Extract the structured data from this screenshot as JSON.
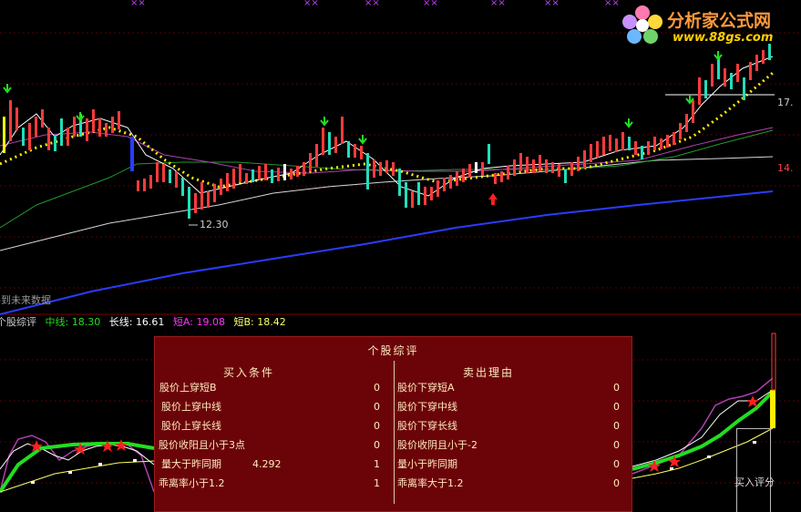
{
  "top_markers": [
    "××",
    "××",
    "××",
    "××",
    "××",
    "××",
    "××"
  ],
  "logo": {
    "name": "分析家公式网",
    "url": "www.88gs.com"
  },
  "price_labels": {
    "low_price": "12.30",
    "right_upper": "17.",
    "right_lower": "14."
  },
  "future_data_text": "得到未来数据",
  "indicator_bar": {
    "name": "个股综评",
    "mid_label": "中线:",
    "mid_value": "18.30",
    "long_label": "长线:",
    "long_value": "16.61",
    "shortA_label": "短A:",
    "shortA_value": "19.08",
    "shortB_label": "短B:",
    "shortB_value": "18.42"
  },
  "colors": {
    "panel_bg": "#6b0408",
    "mid": "#22dd22",
    "long": "#ffffff",
    "shortA": "#ff33ff",
    "shortB": "#ffff66",
    "up": "#ff3b3b",
    "down": "#22ddbb"
  },
  "panel": {
    "title": "个股综评",
    "buy_header": "买入条件",
    "sell_header": "卖出理由",
    "buy_rows": [
      {
        "label": "股价上穿短B",
        "extra": "",
        "value": "0"
      },
      {
        "label": "股价上穿中线",
        "extra": "",
        "value": "0"
      },
      {
        "label": "股价上穿长线",
        "extra": "",
        "value": "0"
      },
      {
        "label": "股价收阳且小于3点",
        "extra": "",
        "value": "0"
      },
      {
        "label": "量大于昨同期",
        "extra": "4.292",
        "value": "1"
      },
      {
        "label": "乖离率小于1.2",
        "extra": "",
        "value": "1"
      }
    ],
    "sell_rows": [
      {
        "label": "股价下穿短A",
        "value": "0"
      },
      {
        "label": "股价下穿中线",
        "value": "0"
      },
      {
        "label": "股价下穿长线",
        "value": "0"
      },
      {
        "label": "股价收阴且小于-2",
        "value": "0"
      },
      {
        "label": "量小于昨同期",
        "value": "0"
      },
      {
        "label": "乖离率大于1.2",
        "value": "0"
      }
    ]
  },
  "score_label": "买入评分",
  "chart_data": {
    "type": "line",
    "title": "",
    "notes": "Candlestick price chart with moving averages; min marked 12.30",
    "low_price": 12.3
  }
}
